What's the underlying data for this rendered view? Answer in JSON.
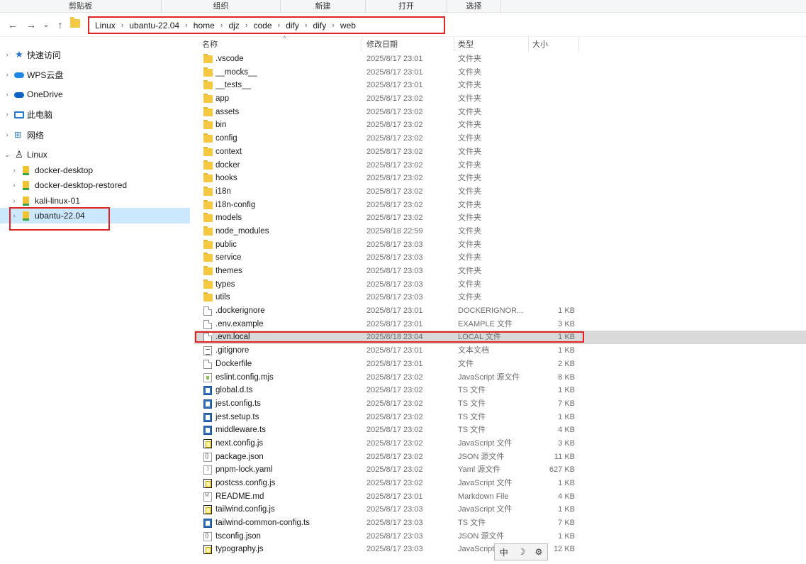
{
  "ribbon": {
    "groups": [
      "剪贴板",
      "组织",
      "新建",
      "打开",
      "选择"
    ]
  },
  "address": {
    "crumbs": [
      "Linux",
      "ubantu-22.04",
      "home",
      "djz",
      "code",
      "dify",
      "dify",
      "web"
    ],
    "back_glyph": "←",
    "forward_glyph": "→",
    "recent_glyph": "⌄",
    "up_glyph": "↑"
  },
  "nav": {
    "items": [
      {
        "label": "快速访问",
        "icon": "star-icon"
      },
      {
        "label": "WPS云盘",
        "icon": "wps-cloud-icon"
      },
      {
        "label": "OneDrive",
        "icon": "onedrive-icon"
      },
      {
        "label": "此电脑",
        "icon": "computer-icon"
      },
      {
        "label": "网络",
        "icon": "network-icon"
      },
      {
        "label": "Linux",
        "icon": "linux-icon"
      },
      {
        "label": "docker-desktop",
        "icon": "drive-icon"
      },
      {
        "label": "docker-desktop-restored",
        "icon": "drive-icon"
      },
      {
        "label": "kali-linux-01",
        "icon": "drive-icon"
      },
      {
        "label": "ubantu-22.04",
        "icon": "drive-icon"
      }
    ]
  },
  "columns": {
    "name": "名称",
    "date": "修改日期",
    "type": "类型",
    "size": "大小"
  },
  "files": [
    {
      "name": ".vscode",
      "date": "2025/8/17 23:01",
      "type": "文件夹",
      "size": "",
      "kind": "folder"
    },
    {
      "name": "__mocks__",
      "date": "2025/8/17 23:01",
      "type": "文件夹",
      "size": "",
      "kind": "folder"
    },
    {
      "name": "__tests__",
      "date": "2025/8/17 23:01",
      "type": "文件夹",
      "size": "",
      "kind": "folder"
    },
    {
      "name": "app",
      "date": "2025/8/17 23:02",
      "type": "文件夹",
      "size": "",
      "kind": "folder"
    },
    {
      "name": "assets",
      "date": "2025/8/17 23:02",
      "type": "文件夹",
      "size": "",
      "kind": "folder"
    },
    {
      "name": "bin",
      "date": "2025/8/17 23:02",
      "type": "文件夹",
      "size": "",
      "kind": "folder"
    },
    {
      "name": "config",
      "date": "2025/8/17 23:02",
      "type": "文件夹",
      "size": "",
      "kind": "folder"
    },
    {
      "name": "context",
      "date": "2025/8/17 23:02",
      "type": "文件夹",
      "size": "",
      "kind": "folder"
    },
    {
      "name": "docker",
      "date": "2025/8/17 23:02",
      "type": "文件夹",
      "size": "",
      "kind": "folder"
    },
    {
      "name": "hooks",
      "date": "2025/8/17 23:02",
      "type": "文件夹",
      "size": "",
      "kind": "folder"
    },
    {
      "name": "i18n",
      "date": "2025/8/17 23:02",
      "type": "文件夹",
      "size": "",
      "kind": "folder"
    },
    {
      "name": "i18n-config",
      "date": "2025/8/17 23:02",
      "type": "文件夹",
      "size": "",
      "kind": "folder"
    },
    {
      "name": "models",
      "date": "2025/8/17 23:02",
      "type": "文件夹",
      "size": "",
      "kind": "folder"
    },
    {
      "name": "node_modules",
      "date": "2025/8/18 22:59",
      "type": "文件夹",
      "size": "",
      "kind": "folder"
    },
    {
      "name": "public",
      "date": "2025/8/17 23:03",
      "type": "文件夹",
      "size": "",
      "kind": "folder"
    },
    {
      "name": "service",
      "date": "2025/8/17 23:03",
      "type": "文件夹",
      "size": "",
      "kind": "folder"
    },
    {
      "name": "themes",
      "date": "2025/8/17 23:03",
      "type": "文件夹",
      "size": "",
      "kind": "folder"
    },
    {
      "name": "types",
      "date": "2025/8/17 23:03",
      "type": "文件夹",
      "size": "",
      "kind": "folder"
    },
    {
      "name": "utils",
      "date": "2025/8/17 23:03",
      "type": "文件夹",
      "size": "",
      "kind": "folder"
    },
    {
      "name": ".dockerignore",
      "date": "2025/8/17 23:01",
      "type": "DOCKERIGNOR...",
      "size": "1 KB",
      "kind": "file"
    },
    {
      "name": ".env.example",
      "date": "2025/8/17 23:01",
      "type": "EXAMPLE 文件",
      "size": "3 KB",
      "kind": "file"
    },
    {
      "name": ".evn.local",
      "date": "2025/8/18 23:04",
      "type": "LOCAL 文件",
      "size": "1 KB",
      "kind": "file"
    },
    {
      "name": ".gitignore",
      "date": "2025/8/17 23:01",
      "type": "文本文档",
      "size": "1 KB",
      "kind": "txt"
    },
    {
      "name": "Dockerfile",
      "date": "2025/8/17 23:01",
      "type": "文件",
      "size": "2 KB",
      "kind": "file"
    },
    {
      "name": "eslint.config.mjs",
      "date": "2025/8/17 23:02",
      "type": "JavaScript 源文件",
      "size": "8 KB",
      "kind": "mjs"
    },
    {
      "name": "global.d.ts",
      "date": "2025/8/17 23:02",
      "type": "TS 文件",
      "size": "1 KB",
      "kind": "ts"
    },
    {
      "name": "jest.config.ts",
      "date": "2025/8/17 23:02",
      "type": "TS 文件",
      "size": "7 KB",
      "kind": "ts"
    },
    {
      "name": "jest.setup.ts",
      "date": "2025/8/17 23:02",
      "type": "TS 文件",
      "size": "1 KB",
      "kind": "ts"
    },
    {
      "name": "middleware.ts",
      "date": "2025/8/17 23:02",
      "type": "TS 文件",
      "size": "4 KB",
      "kind": "ts"
    },
    {
      "name": "next.config.js",
      "date": "2025/8/17 23:02",
      "type": "JavaScript 文件",
      "size": "3 KB",
      "kind": "js"
    },
    {
      "name": "package.json",
      "date": "2025/8/17 23:02",
      "type": "JSON 源文件",
      "size": "11 KB",
      "kind": "json"
    },
    {
      "name": "pnpm-lock.yaml",
      "date": "2025/8/17 23:02",
      "type": "Yaml 源文件",
      "size": "627 KB",
      "kind": "yaml"
    },
    {
      "name": "postcss.config.js",
      "date": "2025/8/17 23:02",
      "type": "JavaScript 文件",
      "size": "1 KB",
      "kind": "js"
    },
    {
      "name": "README.md",
      "date": "2025/8/17 23:01",
      "type": "Markdown File",
      "size": "4 KB",
      "kind": "md"
    },
    {
      "name": "tailwind.config.js",
      "date": "2025/8/17 23:03",
      "type": "JavaScript 文件",
      "size": "1 KB",
      "kind": "js"
    },
    {
      "name": "tailwind-common-config.ts",
      "date": "2025/8/17 23:03",
      "type": "TS 文件",
      "size": "7 KB",
      "kind": "ts"
    },
    {
      "name": "tsconfig.json",
      "date": "2025/8/17 23:03",
      "type": "JSON 源文件",
      "size": "1 KB",
      "kind": "json"
    },
    {
      "name": "typography.js",
      "date": "2025/8/17 23:03",
      "type": "JavaScript",
      "size": "12 KB",
      "kind": "js"
    }
  ],
  "ime": {
    "lang": "中",
    "moon": "☽",
    "tool": "⚙"
  },
  "colors": {
    "highlight_box": "#e02424",
    "selected_nav": "#cce8ff",
    "folder": "#f5c842"
  }
}
